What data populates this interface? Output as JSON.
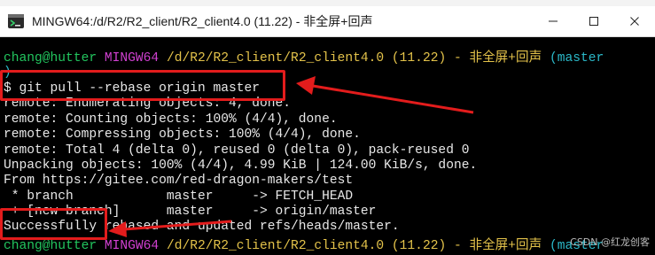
{
  "title_bar": {
    "title": "MINGW64:/d/R2/R2_client/R2_client4.0  (11.22) - 非全屏+回声"
  },
  "terminal": {
    "prompt": {
      "user": "chang@hutter",
      "system": "MINGW64",
      "path": "/d/R2/R2_client/R2_client4.0 (11.22) - 非全屏+回声",
      "branch": "(master"
    },
    "paren_close": ")",
    "command": "$ git pull --rebase origin master",
    "output": [
      "remote: Enumerating objects: 4, done.",
      "remote: Counting objects: 100% (4/4), done.",
      "remote: Compressing objects: 100% (4/4), done.",
      "remote: Total 4 (delta 0), reused 0 (delta 0), pack-reused 0",
      "Unpacking objects: 100% (4/4), 4.99 KiB | 124.00 KiB/s, done.",
      "From https://gitee.com/red-dragon-makers/test",
      " * branch            master     -> FETCH_HEAD",
      " + [new branch]      master     -> origin/master",
      "Successfully rebased and updated refs/heads/master."
    ],
    "next_prompt": {
      "user": "chang@hutter",
      "system": "MINGW64",
      "path": "/d/R2/R2_client/R2_client4.0 (11.22) - 非全屏+回声",
      "branch": "(master"
    }
  },
  "watermark": "CSDN @红龙创客",
  "colors": {
    "annotation": "#e31c1c",
    "prompt_user": "#22c55e",
    "prompt_system": "#d040d0",
    "prompt_path": "#e3c24a",
    "prompt_branch": "#2bb8c8"
  }
}
